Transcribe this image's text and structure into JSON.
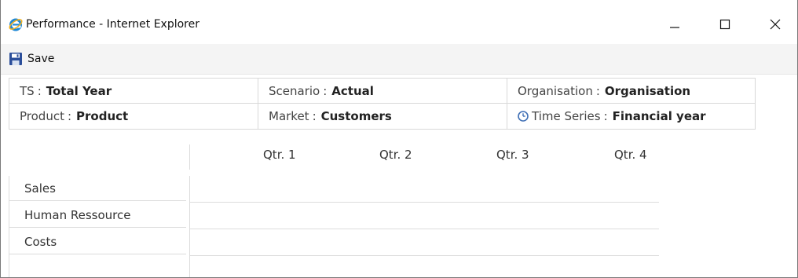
{
  "window": {
    "title": "Performance - Internet Explorer",
    "controls": {
      "minimize": "minimize-icon",
      "maximize": "maximize-icon",
      "close": "close-icon"
    }
  },
  "toolbar": {
    "save_label": "Save",
    "save_icon": "floppy-disk-icon"
  },
  "filters": {
    "ts": {
      "label": "TS",
      "value": "Total Year"
    },
    "scenario": {
      "label": "Scenario",
      "value": "Actual"
    },
    "organisation": {
      "label": "Organisation",
      "value": "Organisation"
    },
    "product": {
      "label": "Product",
      "value": "Product"
    },
    "market": {
      "label": "Market",
      "value": "Customers"
    },
    "time_series": {
      "label": "Time Series",
      "value": "Financial year",
      "icon": "clock-icon"
    },
    "separator": ":"
  },
  "grid": {
    "columns": [
      "Qtr. 1",
      "Qtr. 2",
      "Qtr. 3",
      "Qtr. 4"
    ],
    "rows": [
      "Sales",
      "Human Ressource",
      "Costs"
    ]
  },
  "colors": {
    "ie_blue": "#1e88d6",
    "ie_gold": "#f2b01e",
    "save_icon": "#2b4e9a",
    "clock_icon": "#3f6fb5",
    "grid_line": "#dcdcdc"
  }
}
